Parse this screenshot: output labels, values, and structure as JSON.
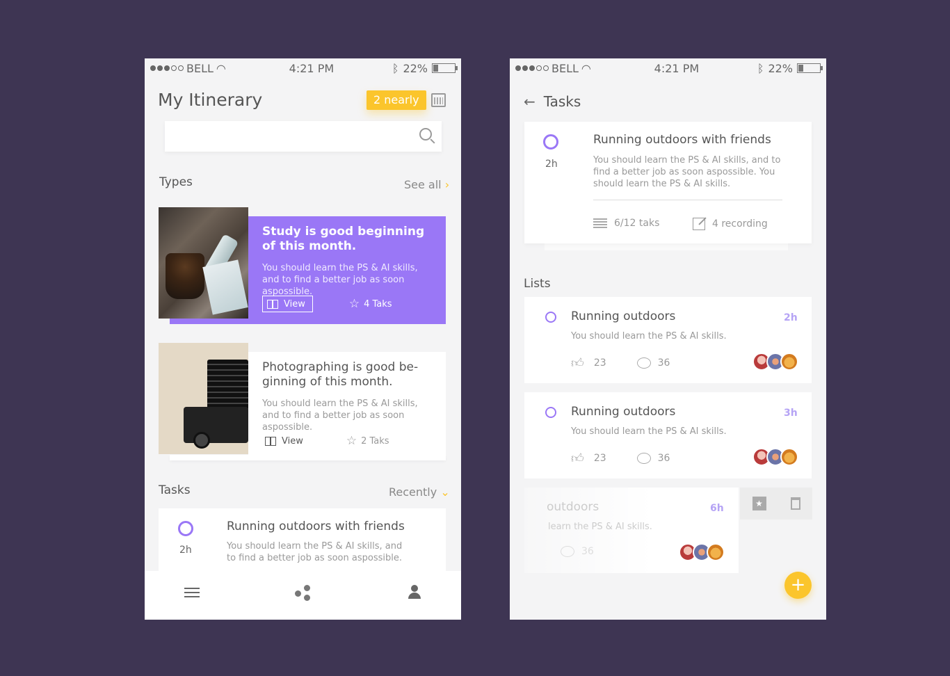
{
  "status": {
    "carrier": "BELL",
    "time": "4:21 PM",
    "battery": "22%"
  },
  "itinerary": {
    "title": "My Itinerary",
    "nearly_badge": "2 nearly",
    "search": {
      "placeholder": ""
    },
    "types_header": "Types",
    "see_all": "See all",
    "cards": [
      {
        "title": "Study is good beginning of this month.",
        "desc": "You should learn the PS & AI skills, and to find a better job as soon aspossible.",
        "view_label": "View",
        "taks": "4 Taks"
      },
      {
        "title": "Photographing is good be- ginning of this month.",
        "desc": "You should learn the PS & AI skills, and to find a better job as soon aspossible.",
        "view_label": "View",
        "taks": "2 Taks"
      }
    ],
    "tasks_header": "Tasks",
    "recently": "Recently",
    "task": {
      "title": "Running outdoors with friends",
      "duration": "2h",
      "desc": "You should learn the PS & AI skills, and to find a better job as soon aspossible."
    }
  },
  "tasks_page": {
    "title": "Tasks",
    "task": {
      "title": "Running outdoors with friends",
      "duration": "2h",
      "desc": "You should learn the PS & AI skills, and to find a better job as soon aspossible. You should learn the PS & AI skills.",
      "taks_count": "6/12 taks",
      "recording": "4 recording"
    },
    "lists_header": "Lists",
    "lists": [
      {
        "title": "Running outdoors",
        "time": "2h",
        "desc": "You should learn the PS & AI skills.",
        "likes": "23",
        "comments": "36"
      },
      {
        "title": "Running outdoors",
        "time": "3h",
        "desc": "You should learn the PS & AI skills.",
        "likes": "23",
        "comments": "36"
      },
      {
        "title": "outdoors",
        "time": "6h",
        "desc": "learn the PS & AI skills.",
        "comments": "36"
      }
    ],
    "fab_label": "+"
  },
  "colors": {
    "background": "#3e3553",
    "accent_purple": "#9a77f6",
    "accent_yellow": "#fbc52c"
  }
}
